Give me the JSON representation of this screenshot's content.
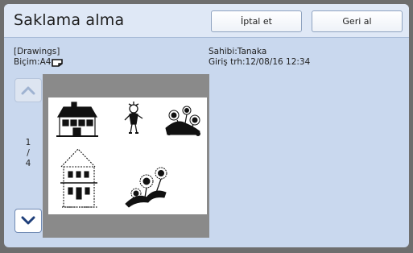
{
  "header": {
    "title": "Saklama alma",
    "cancel_label": "İptal et",
    "undo_label": "Geri al"
  },
  "document": {
    "name": "[Drawings]",
    "format": "Biçim:A4",
    "owner": "Sahibi:Tanaka",
    "entry_date": "Giriş trh:12/08/16 12:34"
  },
  "pager": {
    "current": "1",
    "separator": "/",
    "total": "4"
  },
  "icons": {
    "paper_orientation": "landscape-paper-icon",
    "scroll_up": "chevron-up-icon",
    "scroll_down": "chevron-down-icon"
  },
  "colors": {
    "panel": "#c9d8ee",
    "header": "#dfe8f6",
    "chevron_active": "#1f3f7a",
    "chevron_disabled": "#9fb3d1"
  }
}
